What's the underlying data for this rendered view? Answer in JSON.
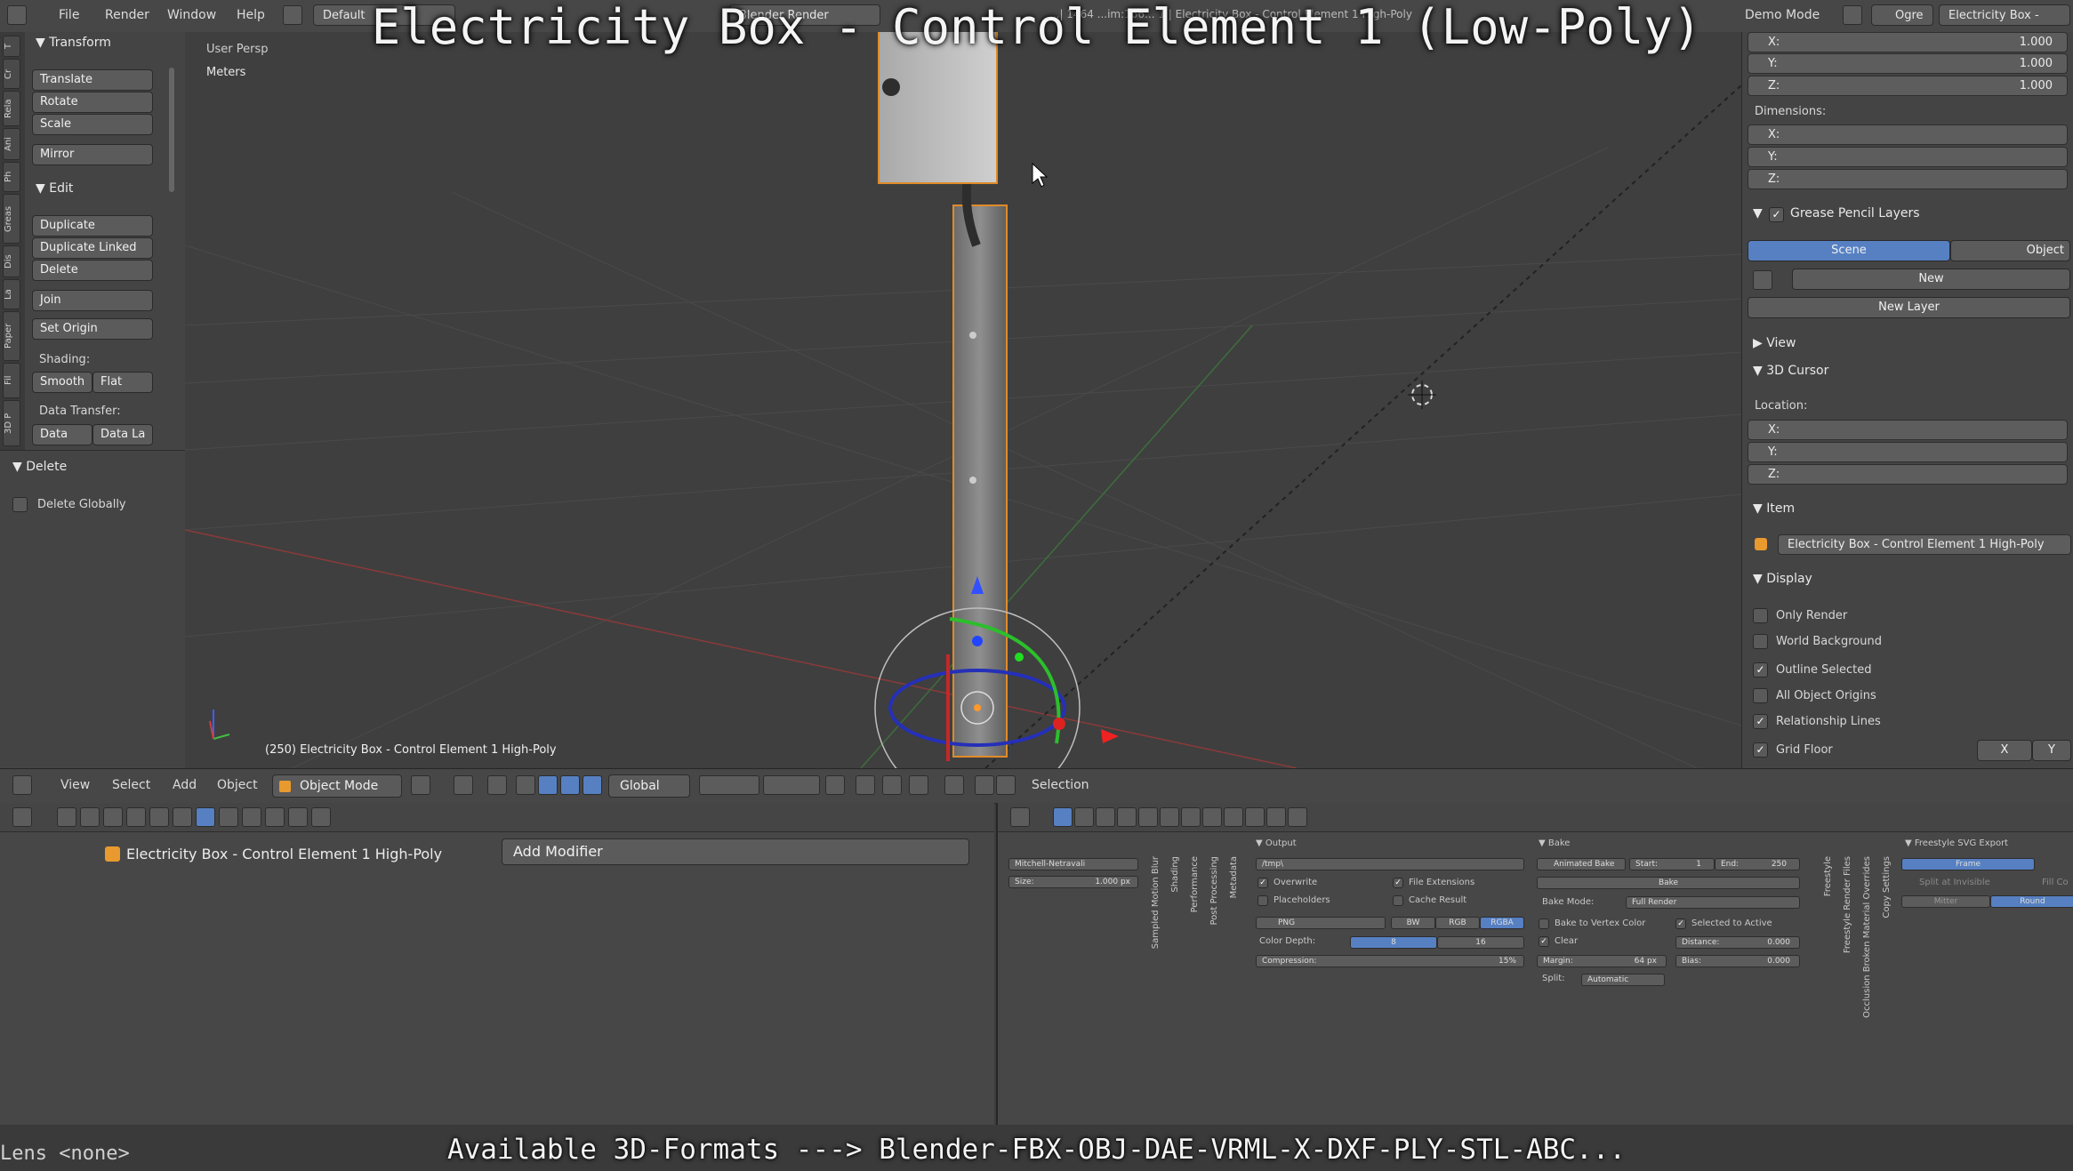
{
  "overlay": {
    "title": "Electricity Box - Control Element 1 (Low-Poly)",
    "formats_caption": "Available 3D-Formats ---> Blender-FBX-OBJ-DAE-VRML-X-DXF-PLY-STL-ABC..."
  },
  "topbar": {
    "menus": [
      "File",
      "Render",
      "Window",
      "Help"
    ],
    "layout_value": "Default",
    "engine_value": "Blender Render",
    "stats_text": "...| 1464 ...im:166... 1 | Electricity Box - Control Element 1 High-Poly",
    "demo_mode": "Demo Mode",
    "ogre": "Ogre",
    "scene_value": "Electricity Box -"
  },
  "toolshelf": {
    "tabs": [
      "T",
      "Cr",
      "Rela",
      "Ani",
      "Ph",
      "Greas",
      "Dis",
      "La",
      "Paper",
      "Fil",
      "3D P"
    ],
    "transform_header": "Transform",
    "translate": "Translate",
    "rotate": "Rotate",
    "scale": "Scale",
    "mirror": "Mirror",
    "edit_header": "Edit",
    "duplicate": "Duplicate",
    "duplicate_linked": "Duplicate Linked",
    "delete": "Delete",
    "join": "Join",
    "set_origin": "Set Origin",
    "shading_label": "Shading:",
    "smooth": "Smooth",
    "flat": "Flat",
    "data_transfer_label": "Data Transfer:",
    "data": "Data",
    "data_la": "Data La"
  },
  "redo_panel": {
    "header": "Delete",
    "delete_globally": "Delete Globally",
    "delete_globally_checked": false
  },
  "viewport": {
    "view_label": "User Persp",
    "units_label": "Meters",
    "object_info": "(250) Electricity Box - Control Element 1 High-Poly"
  },
  "properties": {
    "scale_x_label": "X:",
    "scale_x": "1.000",
    "scale_y_label": "Y:",
    "scale_y": "1.000",
    "scale_z_label": "Z:",
    "scale_z": "1.000",
    "dimensions_label": "Dimensions:",
    "dim_x_label": "X:",
    "dim_y_label": "Y:",
    "dim_z_label": "Z:",
    "grease_pencil_header": "Grease Pencil Layers",
    "scene_tab": "Scene",
    "object_tab": "Object",
    "new": "New",
    "new_layer": "New Layer",
    "view_header": "View",
    "cursor_header": "3D Cursor",
    "location_label": "Location:",
    "loc_x_label": "X:",
    "loc_y_label": "Y:",
    "loc_z_label": "Z:",
    "item_header": "Item",
    "item_name": "Electricity Box - Control Element 1 High-Poly",
    "display_header": "Display",
    "only_render": "Only Render",
    "world_background": "World Background",
    "outline_selected": "Outline Selected",
    "all_object_origins": "All Object Origins",
    "relationship_lines": "Relationship Lines",
    "grid_floor": "Grid Floor",
    "grid_x": "X",
    "grid_y": "Y",
    "checks": {
      "only_render": false,
      "world_background": false,
      "outline_selected": true,
      "all_object_origins": false,
      "relationship_lines": true,
      "grid_floor": true,
      "grease_pencil": true
    }
  },
  "view3d_header": {
    "view": "View",
    "select": "Select",
    "add": "Add",
    "object": "Object",
    "mode": "Object Mode",
    "orientation": "Global",
    "selection_label": "Selection"
  },
  "modifier_editor": {
    "object_name": "Electricity Box - Control Element 1 High-Poly",
    "add_modifier": "Add Modifier"
  },
  "render_editor": {
    "filter": "Mitchell-Netravali",
    "size_label": "Size:",
    "size_value": "1.000 px",
    "vertical_tabs": [
      "Sampled Motion Blur",
      "Shading",
      "Performance",
      "Post Processing",
      "Metadata"
    ],
    "output_header": "Output",
    "output_path": "/tmp\\",
    "overwrite": "Overwrite",
    "file_extensions": "File Extensions",
    "placeholders": "Placeholders",
    "cache_result": "Cache Result",
    "format": "PNG",
    "bw": "BW",
    "rgb": "RGB",
    "rgba": "RGBA",
    "color_depth_label": "Color Depth:",
    "depth_8": "8",
    "depth_16": "16",
    "compression_label": "Compression:",
    "compression_value": "15%",
    "bake_header": "Bake",
    "animated_bake": "Animated Bake",
    "start_label": "Start:",
    "start_value": "1",
    "end_label": "End:",
    "end_value": "250",
    "bake_button": "Bake",
    "bake_mode_label": "Bake Mode:",
    "bake_mode_value": "Full Render",
    "bake_to_vertex_color": "Bake to Vertex Color",
    "selected_to_active": "Selected to Active",
    "clear": "Clear",
    "distance_label": "Distance:",
    "distance_value": "0.000",
    "margin_label": "Margin:",
    "margin_value": "64 px",
    "bias_label": "Bias:",
    "bias_value": "0.000",
    "split_label": "Split:",
    "split_value": "Automatic",
    "freestyle_tabs": [
      "Freestyle",
      "Freestyle Render Files",
      "Occlusion Broken Material Overrides",
      "Copy Settings"
    ],
    "svg_header": "Freestyle SVG Export",
    "frame": "Frame",
    "split_at_invisible": "Split at Invisible",
    "fill": "Fill Co",
    "mitter": "Mitter",
    "round": "Round"
  },
  "status": {
    "lens": "Lens <none>"
  }
}
